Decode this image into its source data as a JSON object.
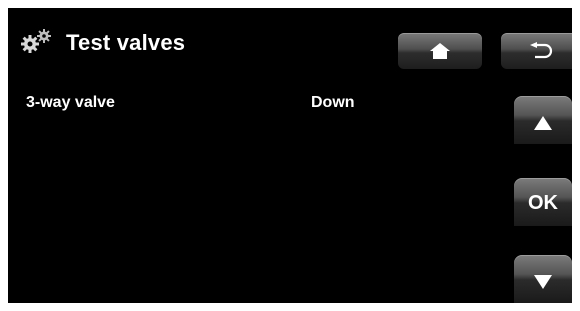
{
  "header": {
    "title": "Test valves",
    "icon": "gears-icon",
    "home_icon": "home-icon",
    "back_icon": "back-arrow-icon"
  },
  "rows": [
    {
      "label": "3-way valve",
      "value": "Down"
    }
  ],
  "side": {
    "up_icon": "up-arrow-icon",
    "ok_label": "OK",
    "down_icon": "down-arrow-icon"
  }
}
